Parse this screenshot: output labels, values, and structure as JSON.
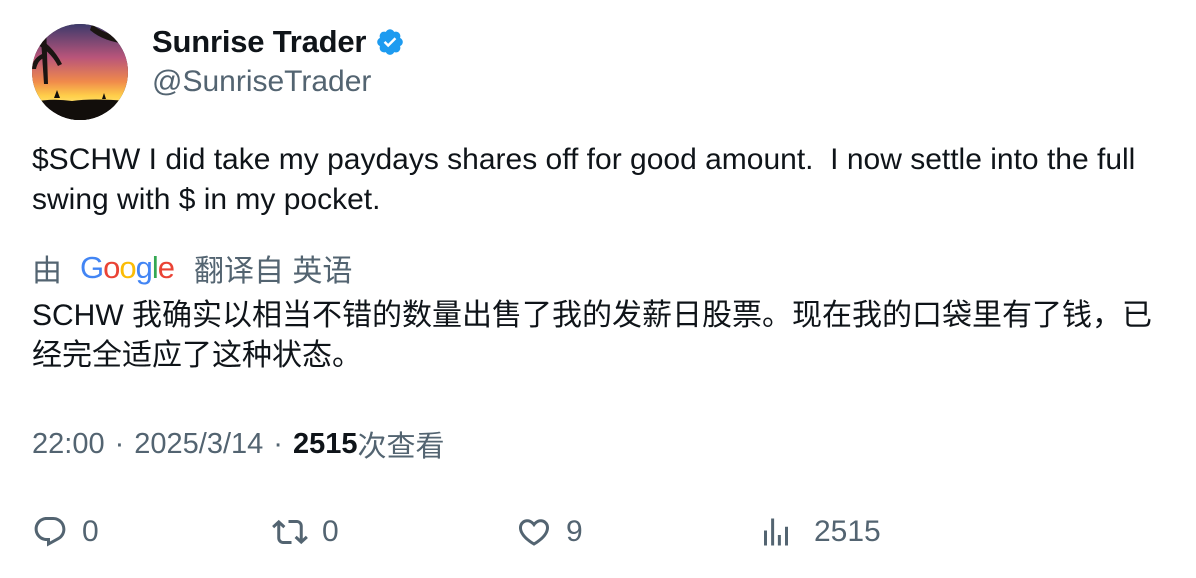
{
  "author": {
    "display_name": "Sunrise Trader",
    "handle": "@SunriseTrader",
    "verified": true,
    "verified_color": "#1d9bf0"
  },
  "tweet": {
    "text": "$SCHW I did take my paydays shares off for good amount.  I now settle into the full swing with $ in my pocket."
  },
  "translation": {
    "by_label": "由",
    "provider": "Google",
    "translated_from_label": "翻译自 英语",
    "text": "SCHW 我确实以相当不错的数量出售了我的发薪日股票。现在我的口袋里有了钱，已经完全适应了这种状态。"
  },
  "meta": {
    "time": "22:00",
    "separator": "·",
    "date": "2025/3/14",
    "views_count": "2515",
    "views_label": "次查看"
  },
  "actions": {
    "reply_count": "0",
    "retweet_count": "0",
    "like_count": "9",
    "views_count": "2515"
  },
  "icons": {
    "reply": "reply-icon",
    "retweet": "retweet-icon",
    "like": "heart-icon",
    "views": "analytics-icon",
    "verified": "verified-badge-icon"
  },
  "colors": {
    "text_primary": "#0f1419",
    "text_secondary": "#536471",
    "google_blue": "#4285f4",
    "google_red": "#ea4335",
    "google_yellow": "#fbbc05",
    "google_green": "#34a853"
  }
}
